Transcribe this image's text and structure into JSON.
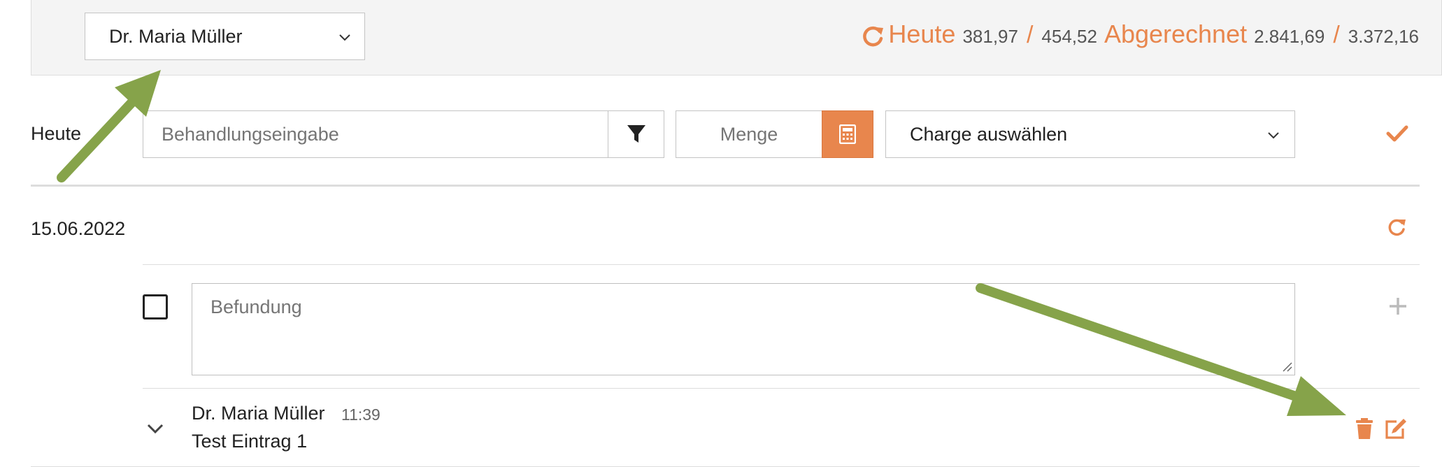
{
  "header": {
    "doctor_select_value": "Dr. Maria Müller",
    "stats": {
      "today_label": "Heute",
      "today_value_1": "381,97",
      "today_value_2": "454,52",
      "billed_label": "Abgerechnet",
      "billed_value_1": "2.841,69",
      "billed_value_2": "3.372,16",
      "separator": "/"
    }
  },
  "entry_row": {
    "day_label": "Heute",
    "treatment_placeholder": "Behandlungseingabe",
    "quantity_placeholder": "Menge",
    "charge_select_value": "Charge auswählen"
  },
  "day": {
    "date": "15.06.2022",
    "findings_placeholder": "Befundung"
  },
  "entries": [
    {
      "author": "Dr. Maria Müller",
      "time": "11:39",
      "text": "Test Eintrag 1"
    }
  ],
  "colors": {
    "accent": "#e8864d",
    "annotation_arrow": "#86a34a",
    "border": "#c4c4c4"
  },
  "icons": [
    "refresh-icon",
    "chevron-down-icon",
    "filter-icon",
    "calculator-icon",
    "check-icon",
    "plus-icon",
    "trash-icon",
    "edit-icon"
  ]
}
